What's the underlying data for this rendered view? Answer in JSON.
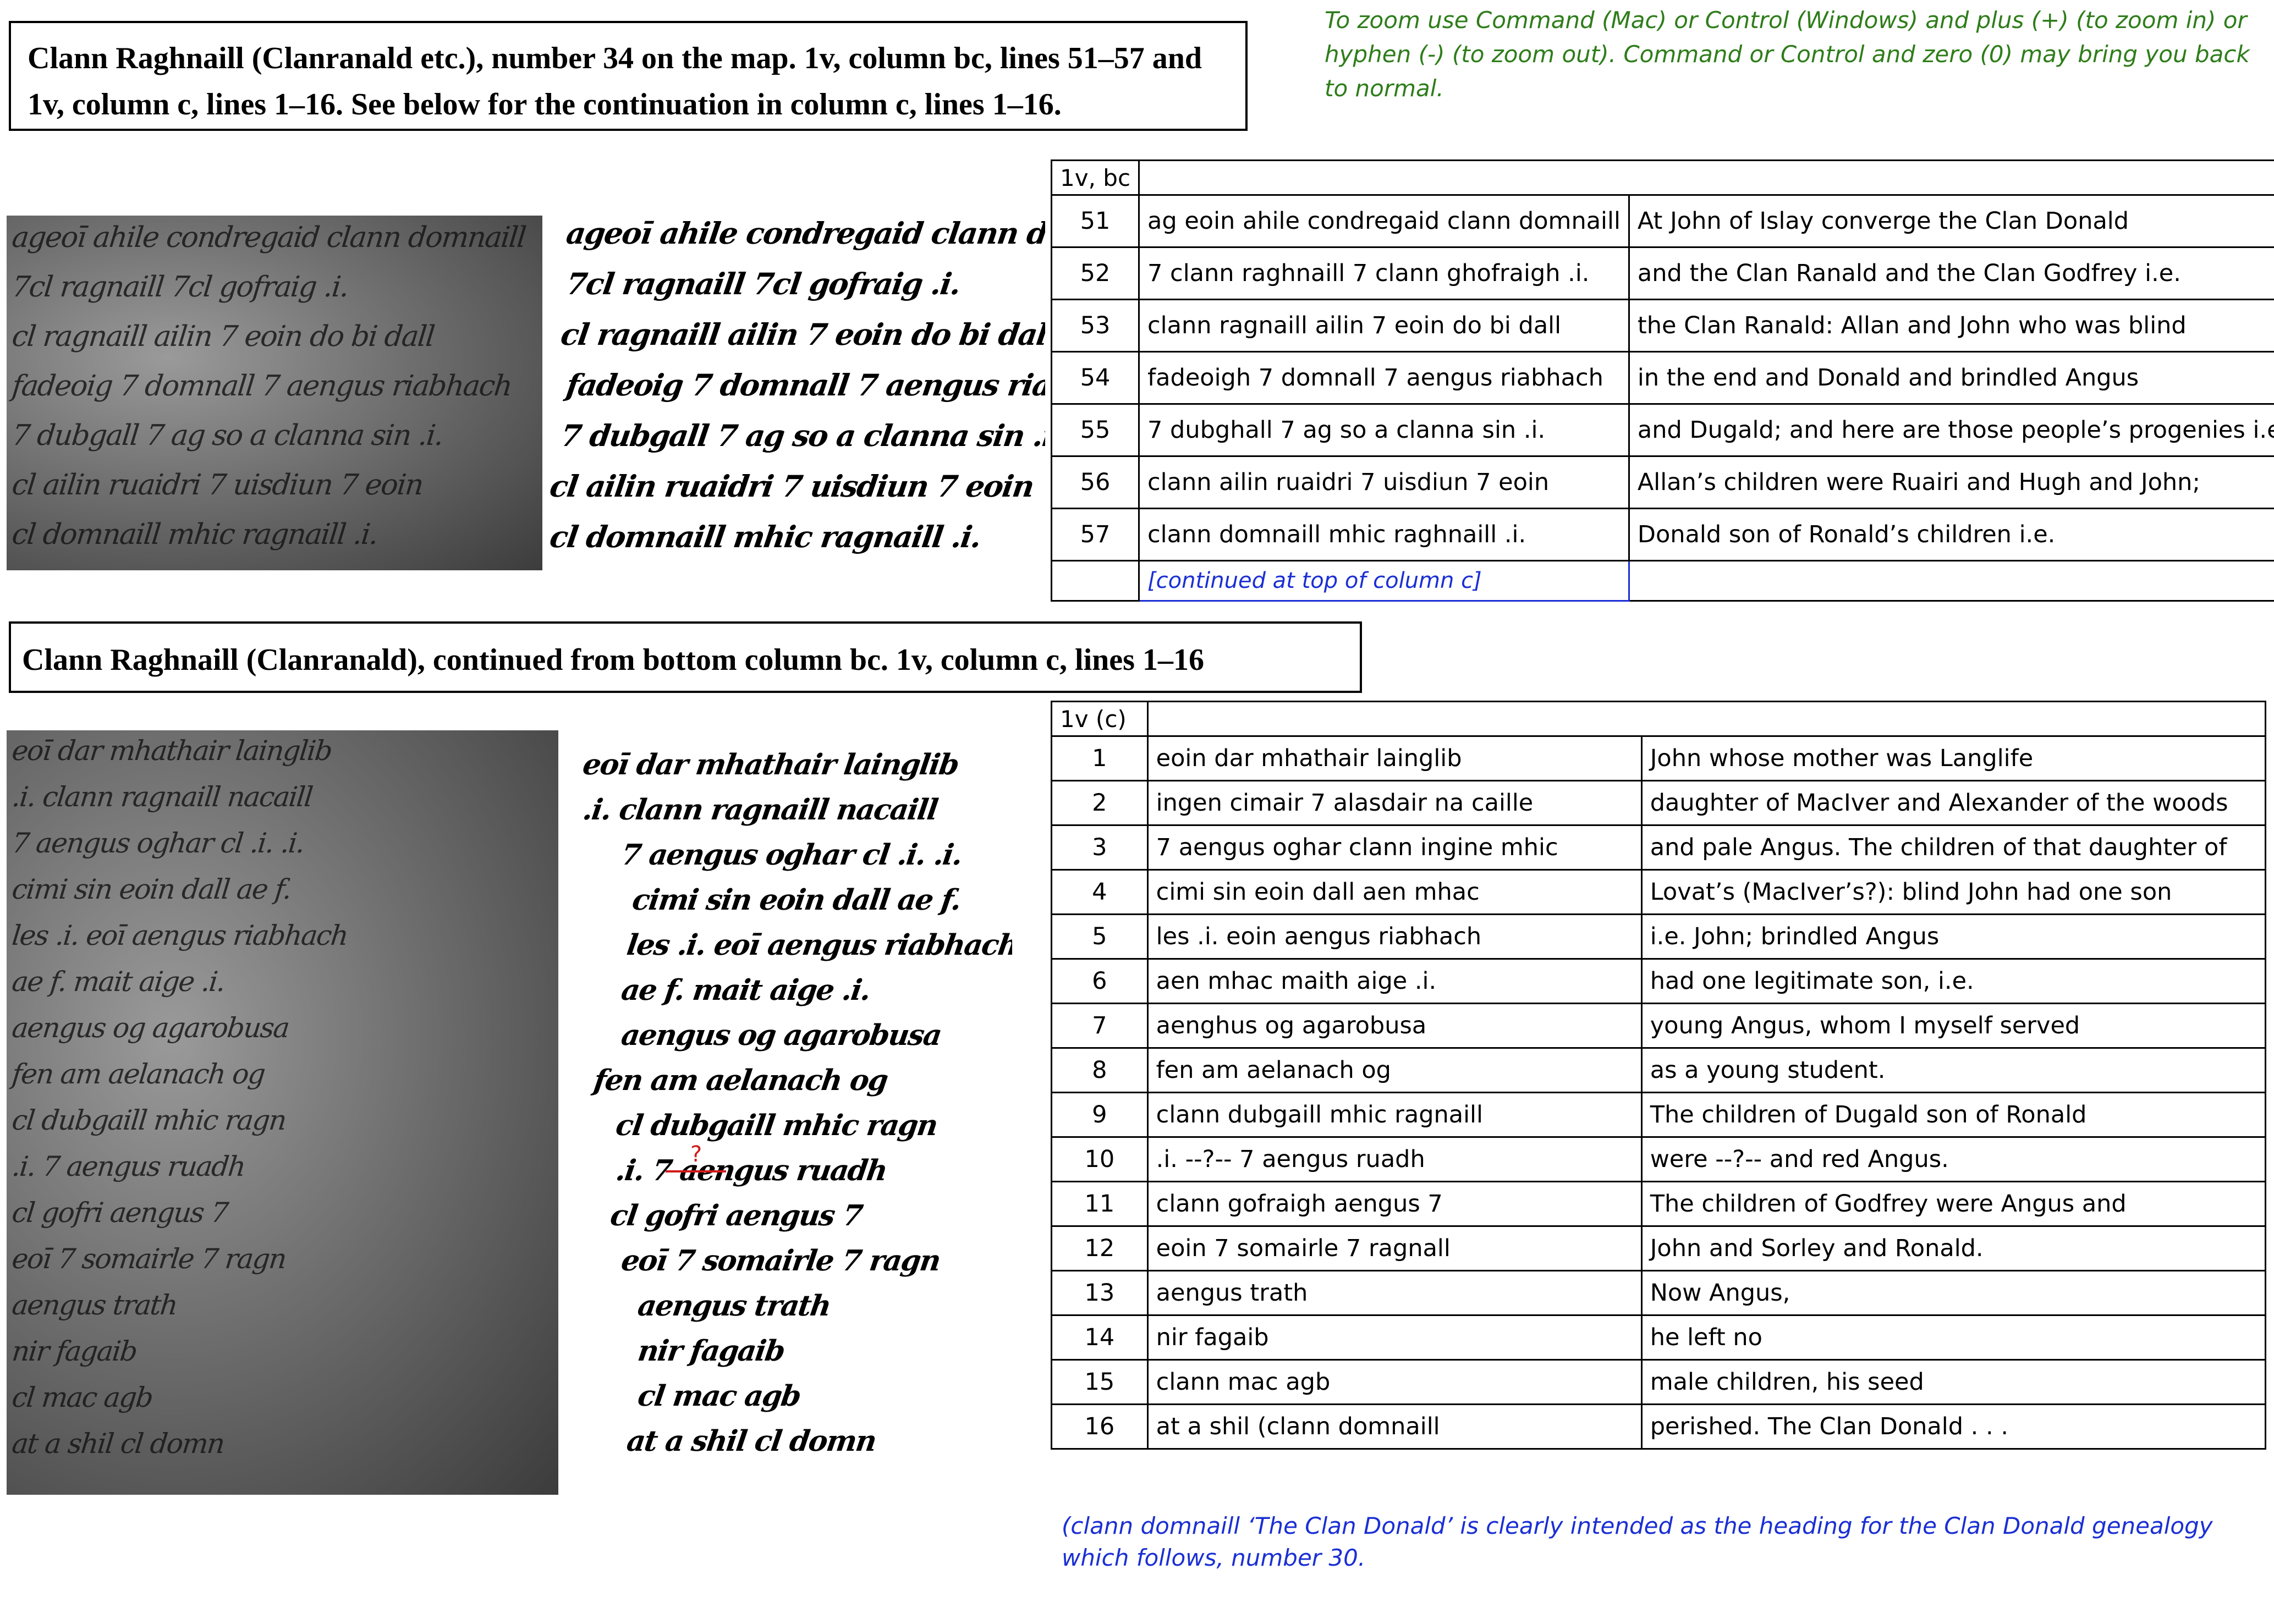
{
  "section1": {
    "title": "Clann Raghnaill (Clanranald etc.), number 34 on the map.  1v, column bc,  lines 51–57 and 1v, column c, lines 1–16. See below for the continuation in column c,  lines 1–16."
  },
  "zoom_note": "To zoom use Command (Mac) or Control (Windows) and plus (+) (to zoom in) or hyphen (-) (to zoom out).  Command or Control and zero (0) may bring you back to normal.",
  "manuscript1": {
    "transcription_lines": [
      "ageoī ahile condregaid clann domnaill",
      "7cl ragnaill 7cl gofraig .i.",
      "cl ragnaill ailin 7 eoin do bi dall",
      "fadeoig 7 domnall 7 aengus riabhach",
      "7 dubgall 7 ag so a clanna sin .i.",
      "cl ailin ruaidri 7 uisdiun 7 eoin",
      "cl domnaill mhic ragnaill .i."
    ]
  },
  "table1": {
    "header": "1v, bc",
    "rows": [
      {
        "num": "51",
        "irish": "ag eoin ahile condregaid clann domnaill",
        "english": "At John of Islay converge the Clan Donald"
      },
      {
        "num": "52",
        "irish": "7 clann raghnaill 7 clann ghofraigh .i.",
        "english": "and the Clan Ranald and the Clan Godfrey i.e."
      },
      {
        "num": "53",
        "irish": "clann ragnaill ailin 7 eoin do bi dall",
        "english": "the Clan Ranald: Allan and John who was blind"
      },
      {
        "num": "54",
        "irish": "fadeoigh 7 domnall 7 aengus riabhach",
        "english": "in the end and Donald and brindled Angus"
      },
      {
        "num": "55",
        "irish": "7 dubghall 7 ag so a clanna sin .i.",
        "english": "and Dugald; and here are those people’s progenies i.e."
      },
      {
        "num": "56",
        "irish": "clann ailin ruaidri 7 uisdiun 7 eoin",
        "english": "Allan’s children were Ruairi and Hugh and John;"
      },
      {
        "num": "57",
        "irish": "clann domnaill mhic raghnaill .i.",
        "english": "Donald son of Ronald’s children i.e."
      }
    ],
    "continued": "[continued at top of column c]"
  },
  "section2": {
    "title": "Clann Raghnaill (Clanranald), continued from bottom column bc. 1v, column c, lines 1–16"
  },
  "manuscript2": {
    "question_mark": "?",
    "transcription_lines": [
      "eoī dar mhathair lainglib",
      ".i. clann ragnaill nacaill",
      "7 aengus oghar cl .i. .i.",
      "cimi sin eoin dall ae f.",
      "les .i. eoī aengus riabhach",
      "ae f. mait aige .i.",
      "aengus og agarobusa",
      "fen am aelanach og",
      "cl dubgaill mhic ragn",
      ".i.        7 aengus ruadh",
      "cl gofri aengus 7",
      "eoī 7 somairle 7 ragn",
      "aengus trath",
      "nir fagaib",
      "cl mac agb",
      "at a shil cl domn"
    ]
  },
  "table2": {
    "header": "1v (c)",
    "rows": [
      {
        "num": "1",
        "irish": "eoin dar mhathair lainglib",
        "english": "John whose mother was Langlife"
      },
      {
        "num": "2",
        "irish": "ingen cimair 7 alasdair na caille",
        "english": "daughter of MacIver and Alexander of the woods"
      },
      {
        "num": "3",
        "irish": "7 aengus oghar clann ingine mhic",
        "english": "and pale Angus. The children of that daughter of"
      },
      {
        "num": "4",
        "irish": "cimi sin eoin dall aen mhac",
        "english": "Lovat’s (MacIver’s?): blind John had one son"
      },
      {
        "num": "5",
        "irish": "les .i. eoin aengus riabhach",
        "english": "i.e. John; brindled Angus"
      },
      {
        "num": "6",
        "irish": "aen mhac maith aige .i.",
        "english": "had one legitimate son, i.e."
      },
      {
        "num": "7",
        "irish": "aenghus og agarobusa",
        "english": "young Angus, whom I myself served"
      },
      {
        "num": "8",
        "irish": "fen am aelanach og",
        "english": "as a young student."
      },
      {
        "num": "9",
        "irish": "clann dubgaill mhic ragnaill",
        "english": "The children of Dugald son of Ronald"
      },
      {
        "num": "10",
        "irish": ".i. --?-- 7 aengus ruadh",
        "english": "were --?-- and red Angus."
      },
      {
        "num": "11",
        "irish": "clann gofraigh aengus 7",
        "english": "The children of Godfrey were Angus and"
      },
      {
        "num": "12",
        "irish": "eoin 7 somairle 7 ragnall",
        "english": "John and Sorley and Ronald."
      },
      {
        "num": "13",
        "irish": "aengus trath",
        "english": "Now Angus,"
      },
      {
        "num": "14",
        "irish": "nir fagaib",
        "english": "he left no"
      },
      {
        "num": "15",
        "irish": "clann mac agb",
        "english": "male children, his seed"
      },
      {
        "num": "16",
        "irish": "at a shil (clann domnaill",
        "english": "perished. The Clan Donald . . ."
      }
    ]
  },
  "bottom_note": "(clann domnaill ‘The Clan Donald’ is clearly intended as the heading for the Clan Donald genealogy which follows, number 30.",
  "colors": {
    "zoom_note": "#2e7d1a",
    "blue_note": "#1a2fd4",
    "question_mark": "#d21a1a"
  }
}
